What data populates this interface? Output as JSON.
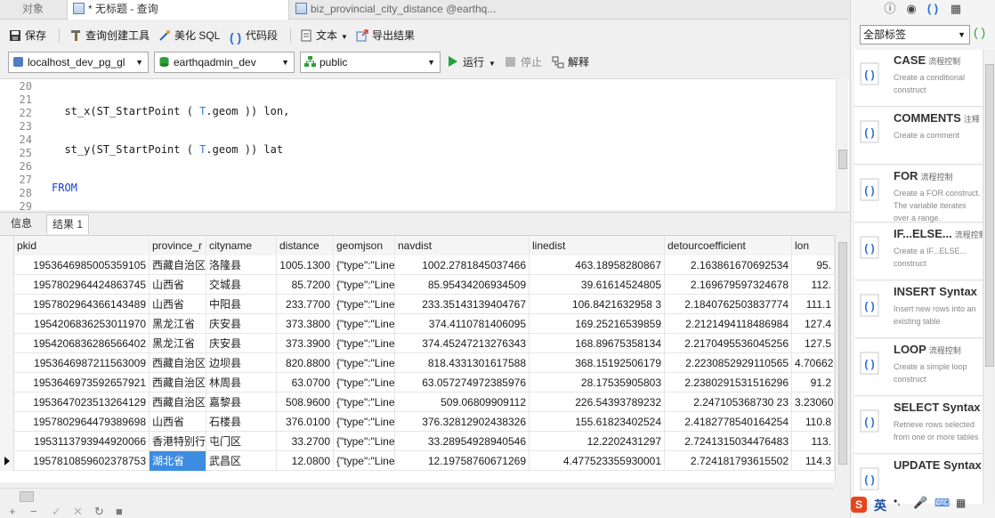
{
  "tabs": [
    {
      "label": "对象"
    },
    {
      "label": "* 无标题 - 查询"
    },
    {
      "label": "biz_provincial_city_distance @earthq..."
    }
  ],
  "toolbar": {
    "save": "保存",
    "query_builder": "查询创建工具",
    "beautify": "美化 SQL",
    "snippet": "代码段",
    "text": "文本",
    "export": "导出结果"
  },
  "conn": {
    "connection": "localhost_dev_pg_gl",
    "database": "earthqadmin_dev",
    "schema": "public",
    "run": "运行",
    "stop": "停止",
    "explain": "解释"
  },
  "editor": {
    "line_numbers": [
      "20",
      "21",
      "22",
      "23",
      "24",
      "25",
      "26",
      "27",
      "28",
      "29"
    ]
  },
  "result_tabs": {
    "info": "信息",
    "result": "结果 1"
  },
  "grid": {
    "columns": [
      "pkid",
      "province_r",
      "cityname",
      "distance",
      "geomjson",
      "navdist",
      "linedist",
      "detourcoefficient",
      "lon"
    ],
    "rows": [
      [
        "1953646985005359105",
        "西藏自治区",
        "洛隆县",
        "1005.1300",
        "{\"type\":\"Line",
        "1002.2781845037466",
        "463.18958280867",
        "2.163861670692534",
        "95."
      ],
      [
        "1957802964424863745",
        "山西省",
        "交城县",
        "85.7200",
        "{\"type\":\"Line",
        "85.95434206934509",
        "39.61614524805",
        "2.169679597324678",
        "112."
      ],
      [
        "1957802964366143489",
        "山西省",
        "中阳县",
        "233.7700",
        "{\"type\":\"Line",
        "233.35143139404767",
        "106.8421632958 3",
        "2.1840762503837774",
        "111.1"
      ],
      [
        "1954206836253011970",
        "黑龙江省",
        "庆安县",
        "373.3800",
        "{\"type\":\"Line",
        "374.4110781406095",
        "169.25216539859",
        "2.2121494118486984",
        "127.4"
      ],
      [
        "1954206836286566402",
        "黑龙江省",
        "庆安县",
        "373.3900",
        "{\"type\":\"Line",
        "374.45247213276343",
        "168.89675358134",
        "2.2170495536045256",
        "127.5"
      ],
      [
        "1953646987211563009",
        "西藏自治区",
        "边坝县",
        "820.8800",
        "{\"type\":\"Line",
        "818.4331301617588",
        "368.15192506179",
        "2.2230852929110565",
        "4.70662"
      ],
      [
        "1953646973592657921",
        "西藏自治区",
        "林周县",
        "63.0700",
        "{\"type\":\"Line",
        "63.057274972385976",
        "28.17535905803",
        "2.2380291531516296",
        "91.2"
      ],
      [
        "1953647023513264129",
        "西藏自治区",
        "嘉黎县",
        "508.9600",
        "{\"type\":\"Line",
        "509.06809909112",
        "226.54393789232",
        "2.247105368730 23",
        "3.23060"
      ],
      [
        "1957802964479389698",
        "山西省",
        "石楼县",
        "376.0100",
        "{\"type\":\"Line",
        "376.32812902438326",
        "155.61823402524",
        "2.4182778540164254",
        "110.8"
      ],
      [
        "1953113793944920066",
        "香港特别行",
        "屯门区",
        "33.2700",
        "{\"type\":\"Line",
        "33.28954928940546",
        "12.2202431297",
        "2.7241315034476483",
        "113."
      ],
      [
        "1957810859602378753",
        "湖北省",
        "武昌区",
        "12.0800",
        "{\"type\":\"Line",
        "12.19758760671269",
        "4.477523355930001",
        "2.724181793615502",
        "114.3"
      ]
    ]
  },
  "side": {
    "filter": "全部标签",
    "snippets": [
      {
        "title": "CASE",
        "tag": "流程控制",
        "desc": "Create a conditional construct"
      },
      {
        "title": "COMMENTS",
        "tag": "注释",
        "desc": "Create a comment"
      },
      {
        "title": "FOR",
        "tag": "流程控制",
        "desc": "Create a FOR construct. The variable iterates over a range."
      },
      {
        "title": "IF...ELSE...",
        "tag": "流程控制",
        "desc": "Create a IF...ELSE... construct"
      },
      {
        "title": "INSERT Syntax",
        "tag": "",
        "desc": "Insert new rows into an existing table"
      },
      {
        "title": "LOOP",
        "tag": "流程控制",
        "desc": "Create a simple loop construct"
      },
      {
        "title": "SELECT Syntax",
        "tag": "",
        "desc": "Retrieve rows selected from one or more tables"
      },
      {
        "title": "UPDATE Syntax",
        "tag": "",
        "desc": ""
      }
    ],
    "ime_label": "英"
  }
}
